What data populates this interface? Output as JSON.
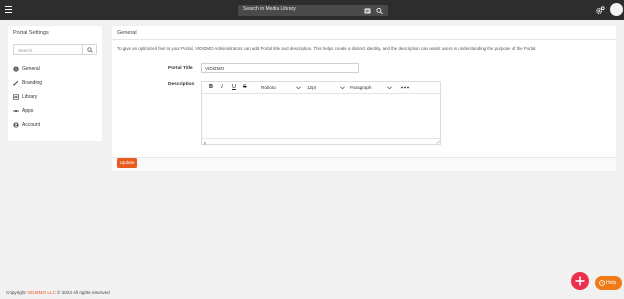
{
  "topbar": {
    "search_placeholder": "Search in Media Library",
    "icons": [
      "menu-icon",
      "filter-icon",
      "search-icon",
      "settings-icon",
      "avatar"
    ]
  },
  "sidebar": {
    "title": "Portal Settings",
    "search_placeholder": "Search",
    "items": [
      {
        "label": "General",
        "icon": "info-icon"
      },
      {
        "label": "Branding",
        "icon": "brush-icon"
      },
      {
        "label": "Library",
        "icon": "library-icon"
      },
      {
        "label": "Apps",
        "icon": "apps-icon"
      },
      {
        "label": "Account",
        "icon": "account-icon"
      }
    ]
  },
  "main": {
    "title": "General",
    "description": "To give an optimized feel to your Portal, VIDIZMO Administrators can add Portal title and description. This helps create a distinct identity, and the description can assist users in understanding the purpose of the Portal.",
    "portal_title_label": "Portal Title",
    "portal_title_value": "VIDIZMO",
    "description_label": "Description",
    "editor": {
      "font": "Roboto",
      "size": "12pt",
      "block": "Paragraph",
      "status_path": "p"
    },
    "update_label": "Update"
  },
  "footer": {
    "prefix": "Copyright ",
    "brand": "VIDIZMO LLC",
    "suffix": " © 2024 All rights reserved"
  },
  "help": {
    "label": "Help"
  },
  "colors": {
    "accent": "#e95a1f",
    "fab": "#ec2f4b",
    "help": "#f07a16",
    "topbar": "#2d2d2d"
  }
}
